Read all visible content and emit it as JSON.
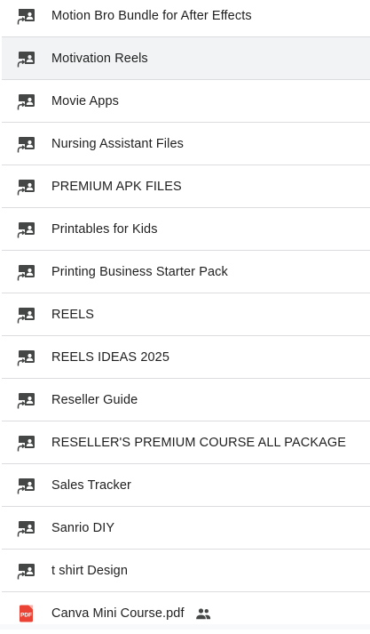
{
  "files": [
    {
      "name": "Motion Bro Bundle for After Effects",
      "type": "shared-folder-icon"
    },
    {
      "name": "Motivation Reels",
      "type": "shared-folder-icon",
      "hovered": true
    },
    {
      "name": "Movie Apps",
      "type": "shared-folder-icon"
    },
    {
      "name": "Nursing Assistant Files",
      "type": "shared-folder-icon"
    },
    {
      "name": "PREMIUM APK FILES",
      "type": "shared-folder-icon"
    },
    {
      "name": "Printables for Kids",
      "type": "shared-folder-icon"
    },
    {
      "name": "Printing Business Starter Pack",
      "type": "shared-folder-icon"
    },
    {
      "name": "REELS",
      "type": "shared-folder-icon"
    },
    {
      "name": "REELS IDEAS 2025",
      "type": "shared-folder-icon"
    },
    {
      "name": "Reseller Guide",
      "type": "shared-folder-icon"
    },
    {
      "name": "RESELLER'S PREMIUM COURSE ALL PACKAGE",
      "type": "shared-folder-icon"
    },
    {
      "name": "Sales Tracker",
      "type": "shared-folder-icon"
    },
    {
      "name": "Sanrio DIY",
      "type": "shared-folder-icon"
    },
    {
      "name": "t shirt Design",
      "type": "shared-folder-icon"
    },
    {
      "name": "Canva Mini Course.pdf",
      "type": "pdf-icon",
      "shared": true
    }
  ],
  "colors": {
    "icon": "#444746",
    "text": "#1f1f1f",
    "pdf": "#ea4335",
    "divider": "#dadce0",
    "hover": "#f1f3f4"
  }
}
